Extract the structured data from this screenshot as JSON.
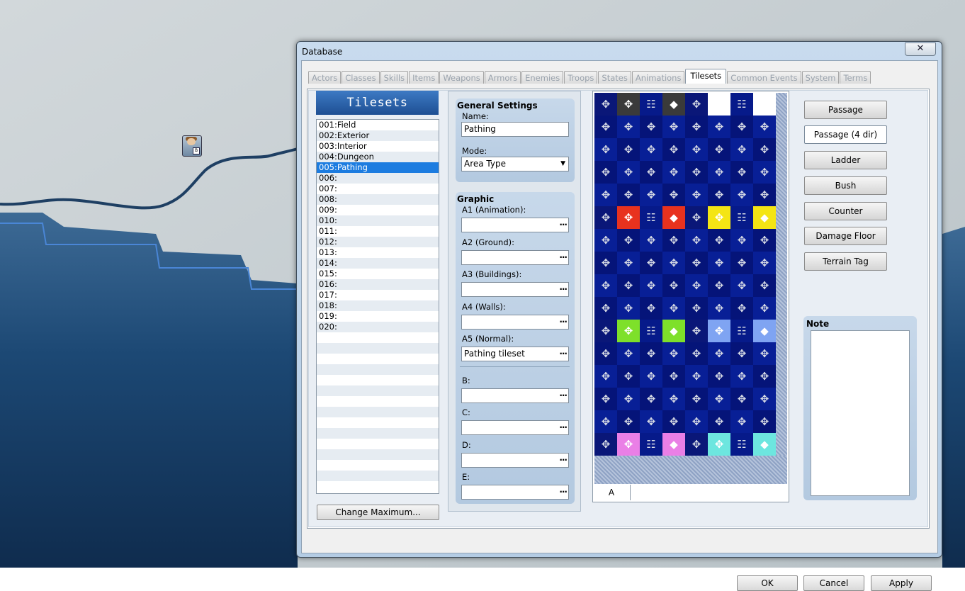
{
  "window": {
    "title": "Database",
    "close_symbol": "✕"
  },
  "tabs": [
    "Actors",
    "Classes",
    "Skills",
    "Items",
    "Weapons",
    "Armors",
    "Enemies",
    "Troops",
    "States",
    "Animations",
    "Tilesets",
    "Common Events",
    "System",
    "Terms"
  ],
  "active_tab": "Tilesets",
  "list": {
    "header": "Tilesets",
    "items": [
      "001:Field",
      "002:Exterior",
      "003:Interior",
      "004:Dungeon",
      "005:Pathing",
      "006:",
      "007:",
      "008:",
      "009:",
      "010:",
      "011:",
      "012:",
      "013:",
      "014:",
      "015:",
      "016:",
      "017:",
      "018:",
      "019:",
      "020:"
    ],
    "selected_index": 4,
    "change_max_label": "Change Maximum..."
  },
  "general": {
    "title": "General Settings",
    "name_label": "Name:",
    "name_value": "Pathing",
    "mode_label": "Mode:",
    "mode_value": "Area Type"
  },
  "graphic": {
    "title": "Graphic",
    "fields": [
      {
        "label": "A1 (Animation):",
        "value": ""
      },
      {
        "label": "A2 (Ground):",
        "value": ""
      },
      {
        "label": "A3 (Buildings):",
        "value": ""
      },
      {
        "label": "A4 (Walls):",
        "value": ""
      },
      {
        "label": "A5 (Normal):",
        "value": "Pathing tileset"
      },
      {
        "label": "B:",
        "value": ""
      },
      {
        "label": "C:",
        "value": ""
      },
      {
        "label": "D:",
        "value": ""
      },
      {
        "label": "E:",
        "value": ""
      }
    ],
    "browse_symbol": "..."
  },
  "tile_tab_label": "A",
  "tile_colors": [
    "#ffffff",
    "#e8321e",
    "#f4e514",
    "#7ee02a",
    "#7fa4f2",
    "#ea7fe6",
    "#6de6df",
    "#3a3a3a"
  ],
  "mode_buttons": [
    "Passage",
    "Passage (4 dir)",
    "Ladder",
    "Bush",
    "Counter",
    "Damage Floor",
    "Terrain Tag"
  ],
  "active_mode": "Passage (4 dir)",
  "note": {
    "label": "Note",
    "value": ""
  },
  "buttons": {
    "ok": "OK",
    "cancel": "Cancel",
    "apply": "Apply"
  }
}
